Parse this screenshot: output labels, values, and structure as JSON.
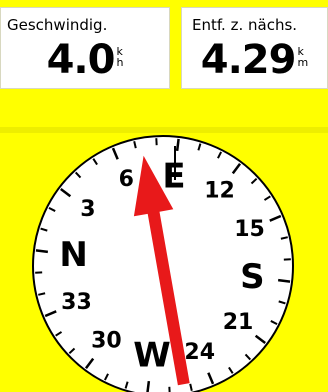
{
  "data_fields": [
    {
      "label": "Geschwindig.",
      "value": "4.0",
      "unit_top": "k",
      "unit_bottom": "h"
    },
    {
      "label": "Entf. z. nächs.",
      "value": "4.29",
      "unit_top": "k",
      "unit_bottom": "m"
    }
  ],
  "compass": {
    "heading_deg": 83,
    "bearing_pointer_deg": 73,
    "cardinals": {
      "n": "N",
      "e": "E",
      "s": "S",
      "w": "W"
    },
    "numbers": [
      "3",
      "6",
      "12",
      "15",
      "21",
      "24",
      "30",
      "33"
    ],
    "pointer_color": "#e8191a",
    "dial_color": "#ffffff"
  },
  "colors": {
    "background": "#ffff00"
  }
}
